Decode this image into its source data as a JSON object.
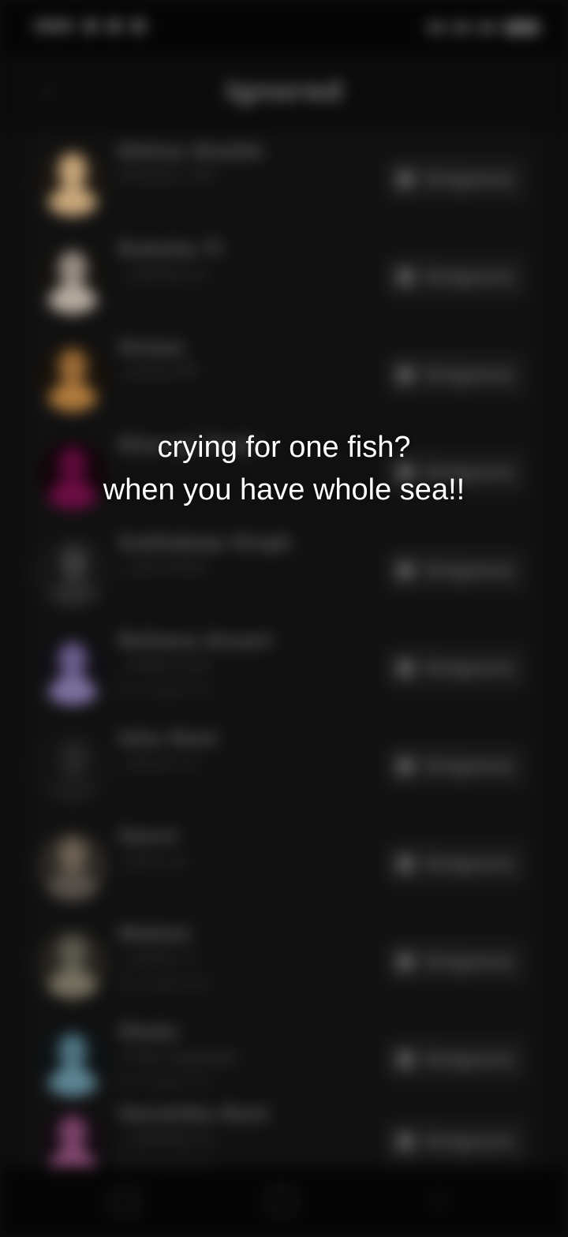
{
  "header": {
    "title": "Ignored",
    "back_glyph": "‹"
  },
  "unmute_label": "Unignore",
  "rows": [
    {
      "name": "Ehtisa Shaikh",
      "handle": "ehtisaa1.702",
      "extra": "",
      "avatar_head": "#c9a77a",
      "avatar_body": "#c9a77a",
      "avatar_bg": "#1a1510"
    },
    {
      "name": "Ruksha Ti",
      "handle": "_rukshaa.xx",
      "extra": "",
      "avatar_head": "#9a8f86",
      "avatar_body": "#b7aba0",
      "avatar_bg": "#14120f"
    },
    {
      "name": "Anaya",
      "handle": "_anaya.ffff",
      "extra": "",
      "avatar_head": "#9c6c36",
      "avatar_body": "#b07a3c",
      "avatar_bg": "#17110a"
    },
    {
      "name": "Dhanaji Dodo",
      "handle": "",
      "extra": "",
      "avatar_head": "#5e0a3a",
      "avatar_body": "#6c0c44",
      "avatar_bg": "#110409"
    },
    {
      "name": "Sukhdeep Singh",
      "handle": "_sukh.ttttttt",
      "extra": "",
      "avatar_head": "#3a3a3a",
      "avatar_body": "#2a2a2a",
      "avatar_bg": "#151515"
    },
    {
      "name": "Rehana Ansari",
      "handle": "_rehana.ooo",
      "extra": "Aa Suggested",
      "avatar_head": "#6b5e8e",
      "avatar_body": "#7d70a0",
      "avatar_bg": "#100e14"
    },
    {
      "name": "Ishu Rani",
      "handle": "_ishuuu.xx",
      "extra": "",
      "avatar_head": "#262626",
      "avatar_body": "#1b1b1b",
      "avatar_bg": "#131313"
    },
    {
      "name": "Sanvi",
      "handle": "_sanvi.xx",
      "extra": "",
      "avatar_head": "#6e6254",
      "avatar_body": "#575049",
      "avatar_bg": "#2c2824"
    },
    {
      "name": "Mohini",
      "handle": "_mohini.rrr",
      "extra": "Aa Suggested",
      "avatar_head": "#5a5a4e",
      "avatar_body": "#777060",
      "avatar_bg": "#26231e"
    },
    {
      "name": "Shalu",
      "handle": "_shalu.ggggggg",
      "extra": "Aa Suggested",
      "avatar_head": "#4f7584",
      "avatar_body": "#5d8594",
      "avatar_bg": "#0c1214"
    },
    {
      "name": "Vanshika Rani",
      "handle": "_vanshika.xx",
      "extra": "Aa Suggested",
      "avatar_head": "#7a4268",
      "avatar_body": "#8a4c77",
      "avatar_bg": "#120a10"
    }
  ],
  "caption": {
    "line1": "crying for one fish?",
    "line2": "when you have whole sea!!"
  },
  "nav": {
    "back_glyph": "‹"
  }
}
